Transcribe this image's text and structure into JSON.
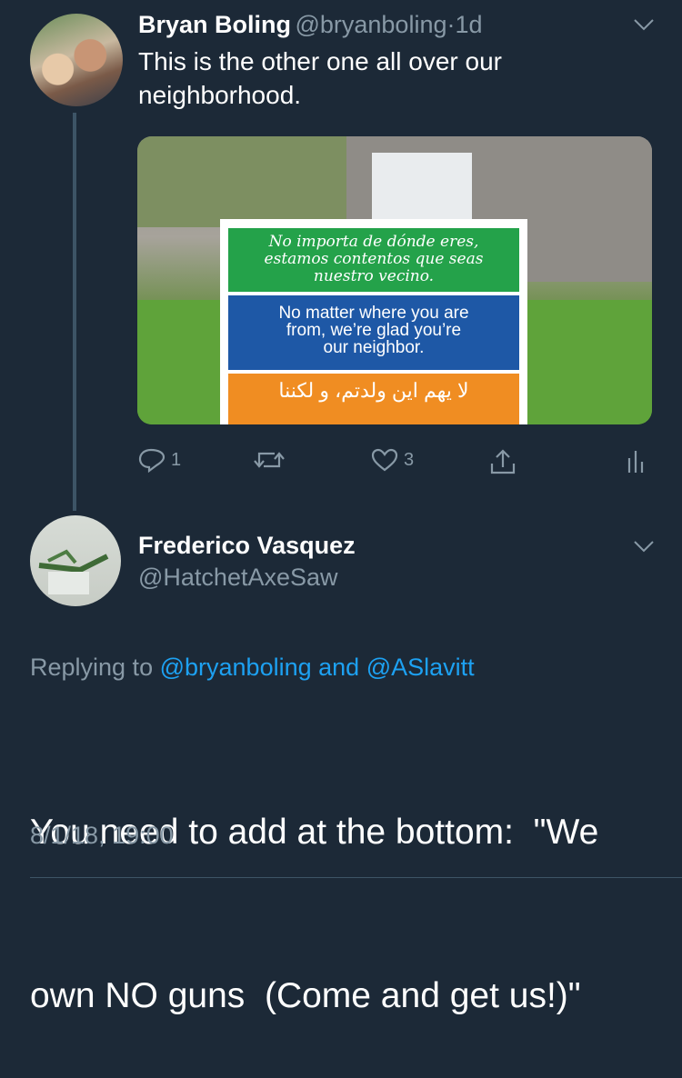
{
  "tweet1": {
    "name": "Bryan Boling",
    "handle": "@bryanboling",
    "separator": "·",
    "time": "1d",
    "text_line1": "This is the other one all over our",
    "text_line2": "neighborhood.",
    "media": {
      "sign_spanish_l1": "No importa de dónde eres,",
      "sign_spanish_l2": "estamos contentos que seas",
      "sign_spanish_l3": "nuestro vecino.",
      "sign_english_l1": "No matter where you are",
      "sign_english_l2": "from, we’re glad you’re",
      "sign_english_l3": "our neighbor.",
      "sign_arabic": "لا يهم اين ولدتم، و لكننا"
    },
    "actions": {
      "reply_count": "1",
      "like_count": "3"
    }
  },
  "tweet2": {
    "name": "Frederico Vasquez",
    "handle": "@HatchetAxeSaw",
    "replying_prefix": "Replying to",
    "replying_user1": "@bryanboling",
    "replying_and": "and",
    "replying_user2": "@ASlavitt",
    "text_line1": "You need to add at the bottom:  \"We",
    "text_line2": "own NO guns  (Come and get us!)\"",
    "timestamp": "8/1/18, 19:00"
  },
  "colors": {
    "background": "#1c2937",
    "muted": "#8899a6",
    "link": "#1da1f2"
  }
}
